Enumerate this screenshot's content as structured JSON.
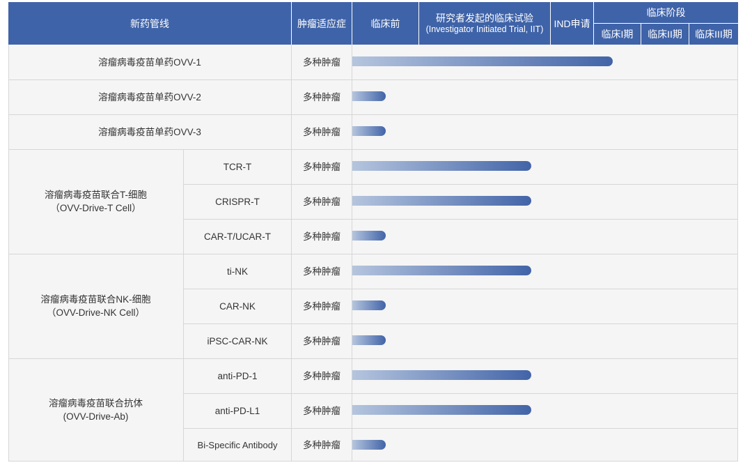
{
  "header": {
    "pipeline": "新药管线",
    "indication": "肿瘤适应症",
    "preclinical": "临床前",
    "iit_line1": "研究者发起的临床试验",
    "iit_line2": "(Investigator Initiated Trial, IIT)",
    "ind": "IND申请",
    "clinical_stage": "临床阶段",
    "phase1": "临床I期",
    "phase2": "临床II期",
    "phase3": "临床III期"
  },
  "groups": [
    {
      "line1": "溶瘤病毒疫苗联合T-细胞",
      "line2": "（OVV-Drive-T Cell）"
    },
    {
      "line1": "溶瘤病毒疫苗联合NK-细胞",
      "line2": "（OVV-Drive-NK Cell）"
    },
    {
      "line1": "溶瘤病毒疫苗联合抗体",
      "line2": "(OVV-Drive-Ab)"
    }
  ],
  "rows": [
    {
      "name": "溶瘤病毒疫苗单药OVV-1",
      "indication": "多种肿瘤"
    },
    {
      "name": "溶瘤病毒疫苗单药OVV-2",
      "indication": "多种肿瘤"
    },
    {
      "name": "溶瘤病毒疫苗单药OVV-3",
      "indication": "多种肿瘤"
    },
    {
      "name": "TCR-T",
      "indication": "多种肿瘤"
    },
    {
      "name": "CRISPR-T",
      "indication": "多种肿瘤"
    },
    {
      "name": "CAR-T/UCAR-T",
      "indication": "多种肿瘤"
    },
    {
      "name": "ti-NK",
      "indication": "多种肿瘤"
    },
    {
      "name": "CAR-NK",
      "indication": "多种肿瘤"
    },
    {
      "name": "iPSC-CAR-NK",
      "indication": "多种肿瘤"
    },
    {
      "name": "anti-PD-1",
      "indication": "多种肿瘤"
    },
    {
      "name": "anti-PD-L1",
      "indication": "多种肿瘤"
    },
    {
      "name": "Bi-Specific Antibody",
      "indication": "多种肿瘤"
    }
  ],
  "chart_data": {
    "type": "bar",
    "orientation": "horizontal",
    "stages": [
      "临床前",
      "研究者发起的临床试验 (Investigator Initiated Trial, IIT)",
      "IND申请",
      "临床I期",
      "临床II期",
      "临床III期"
    ],
    "categories": [
      "溶瘤病毒疫苗单药OVV-1",
      "溶瘤病毒疫苗单药OVV-2",
      "溶瘤病毒疫苗单药OVV-3",
      "TCR-T",
      "CRISPR-T",
      "CAR-T/UCAR-T",
      "ti-NK",
      "CAR-NK",
      "iPSC-CAR-NK",
      "anti-PD-1",
      "anti-PD-L1",
      "Bi-Specific Antibody"
    ],
    "values": [
      3.4,
      0.5,
      0.5,
      1.85,
      1.85,
      0.5,
      1.85,
      0.5,
      0.5,
      1.85,
      1.85,
      0.5
    ],
    "value_unit": "stages completed (0–6, measured from start of 临床前)",
    "colors": {
      "start": "#b5c5de",
      "end": "#4264a8",
      "header": "#3f63a8"
    }
  }
}
